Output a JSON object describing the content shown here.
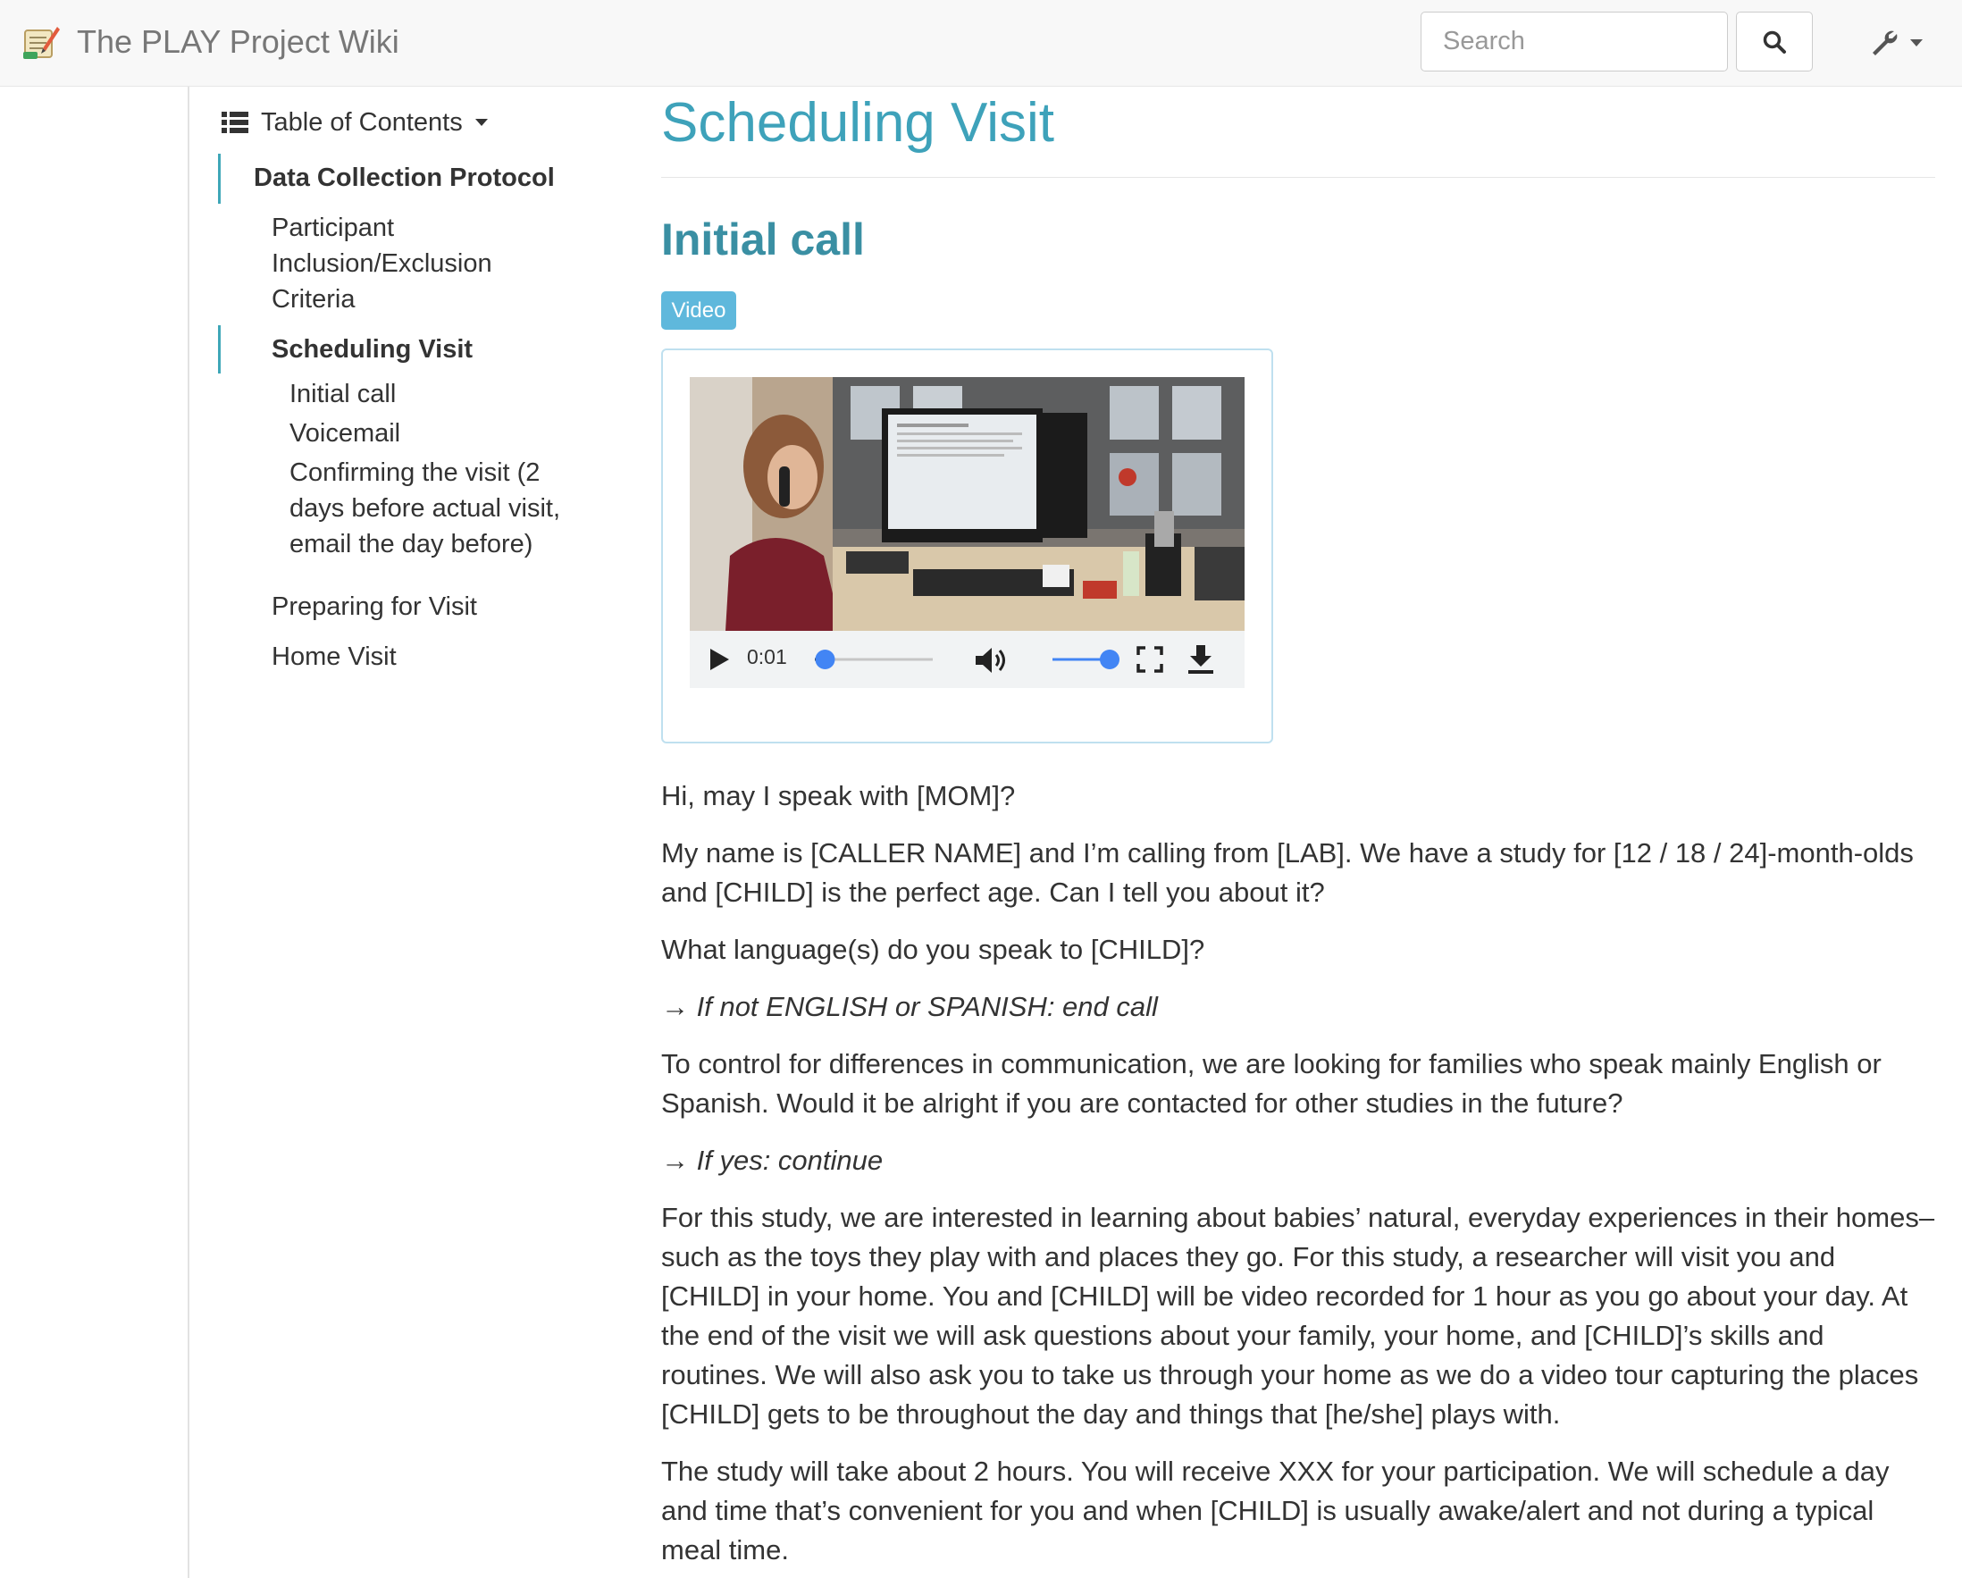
{
  "navbar": {
    "brand": "The PLAY Project Wiki",
    "search_placeholder": "Search",
    "search_icon": "search-icon",
    "tools_icon": "wrench-icon"
  },
  "toc": {
    "header": "Table of Contents",
    "items": [
      {
        "label": "Data Collection Protocol",
        "level": 1,
        "active": true
      },
      {
        "label": "Participant Inclusion/Exclusion Criteria",
        "level": 2
      },
      {
        "label": "Scheduling Visit",
        "level": 2,
        "active": true
      },
      {
        "label": "Initial call",
        "level": 3
      },
      {
        "label": "Voicemail",
        "level": 3
      },
      {
        "label": "Confirming the visit (2 days before actual visit, email the day before)",
        "level": 3
      },
      {
        "label": "Preparing for Visit",
        "level": 2
      },
      {
        "label": "Home Visit",
        "level": 2
      }
    ]
  },
  "main": {
    "title": "Scheduling Visit",
    "section_title": "Initial call",
    "badge": "Video",
    "video": {
      "time": "0:01",
      "progress": 0.03,
      "volume": 1.0
    },
    "paragraphs": [
      {
        "text": "Hi, may I speak with [MOM]?",
        "italic": false
      },
      {
        "text": "My name is [CALLER NAME] and I’m calling from [LAB]. We have a study for [12 / 18 / 24]-month-olds and [CHILD] is the perfect age. Can I tell you about it?",
        "italic": false
      },
      {
        "text": "What language(s) do you speak to [CHILD]?",
        "italic": false
      },
      {
        "text": "→ If not ENGLISH or SPANISH: end call",
        "italic": true
      },
      {
        "text": "To control for differences in communication, we are looking for families who speak mainly English or Spanish. Would it be alright if you are contacted for other studies in the future?",
        "italic": false
      },
      {
        "text": "→ If yes: continue",
        "italic": true
      },
      {
        "text": "For this study, we are interested in learning about babies’ natural, everyday experiences in their homes–such as the toys they play with and places they go. For this study, a researcher will visit you and [CHILD] in your home. You and [CHILD] will be video recorded for 1 hour as you go about your day. At the end of the visit we will ask questions about your family, your home, and [CHILD]’s skills and routines. We will also ask you to take us through your home as we do a video tour capturing the places [CHILD] gets to be throughout the day and things that [he/she] plays with.",
        "italic": false
      },
      {
        "text": "The study will take about 2 hours. You will receive XXX for your participation. We will schedule a day and time that’s convenient for you and when [CHILD] is usually awake/alert and not during a typical meal time.",
        "italic": false
      }
    ]
  },
  "colors": {
    "accent": "#3ea2ba",
    "section": "#3a8fa3",
    "badge": "#5fb8dc",
    "toc_bar": "#3fa7b8",
    "slider": "#4285f4"
  }
}
